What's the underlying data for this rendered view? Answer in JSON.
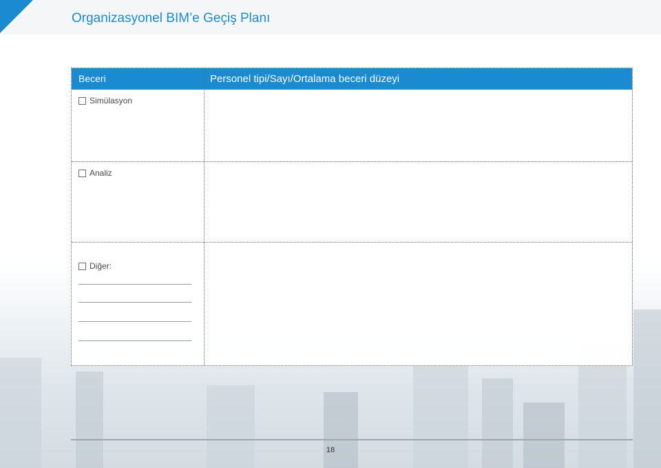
{
  "header": {
    "title": "Organizasyonel BIM’e Geçiş Planı",
    "accent_color": "#1a8bd1"
  },
  "table": {
    "column_headers": [
      "Beceri",
      "Personel tipi/Sayı/Ortalama beceri düzeyi"
    ],
    "rows": [
      {
        "option_label": "Simülasyon",
        "value": ""
      },
      {
        "option_label": "Analiz",
        "value": ""
      },
      {
        "option_label": "Diğer:",
        "value": ""
      }
    ]
  },
  "footer": {
    "page_number": "18"
  }
}
